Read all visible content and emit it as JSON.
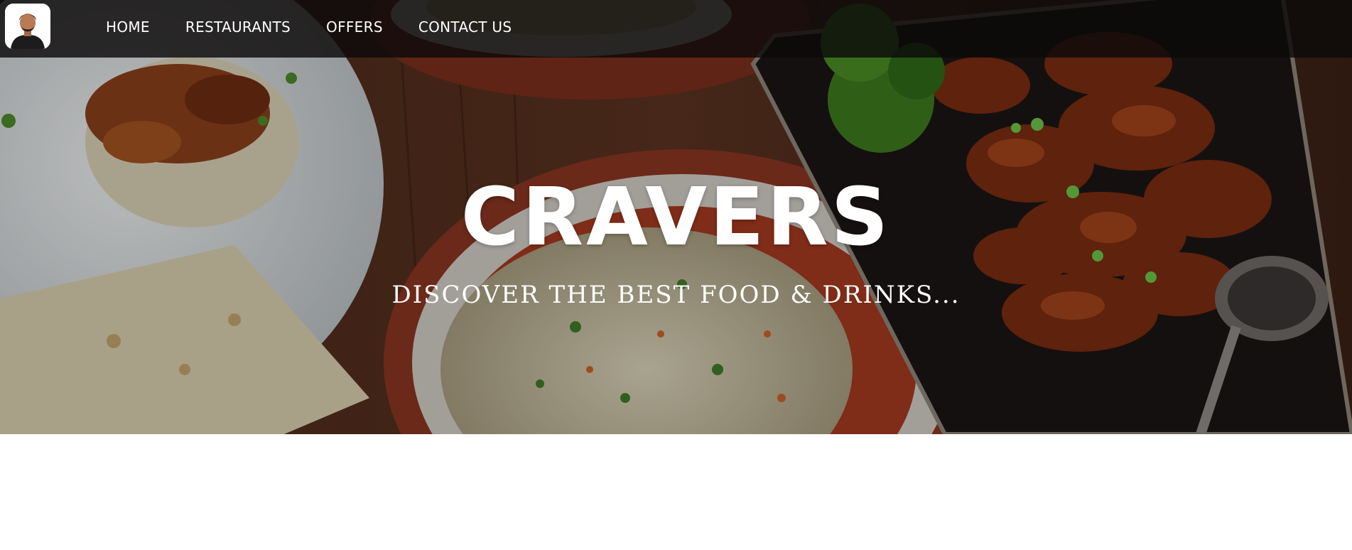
{
  "navbar": {
    "logo_alt": "profile avatar",
    "links": [
      {
        "label": "HOME"
      },
      {
        "label": "RESTAURANTS"
      },
      {
        "label": "OFFERS"
      },
      {
        "label": "CONTACT US"
      }
    ]
  },
  "hero": {
    "brand": "CRAVERS",
    "tagline": "DISCOVER THE BEST FOOD & DRINKS..."
  },
  "colors": {
    "navbar_bg": "#0c0a0a",
    "text": "#ffffff",
    "page_bg": "#ffffff"
  }
}
